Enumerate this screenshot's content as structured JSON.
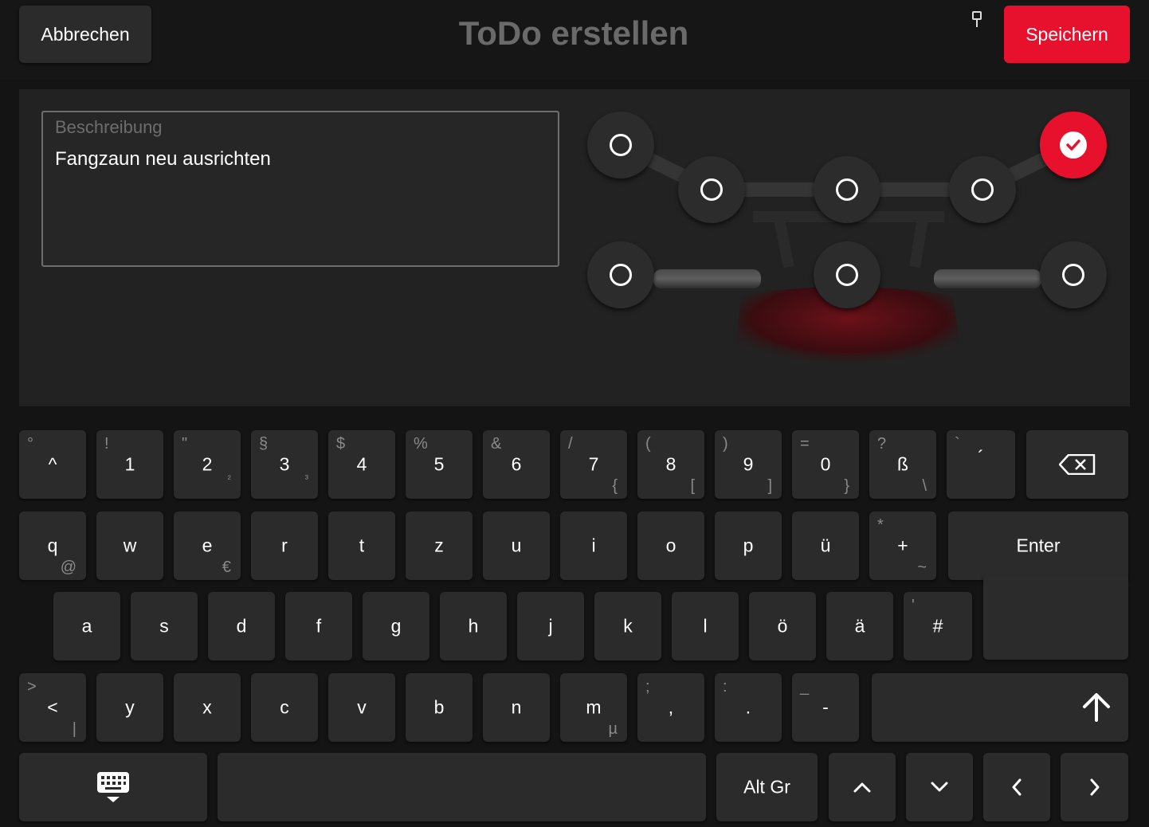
{
  "header": {
    "cancel_label": "Abbrechen",
    "title": "ToDo erstellen",
    "save_label": "Speichern",
    "accent_color": "#e8112d"
  },
  "description": {
    "label": "Beschreibung",
    "value": "Fangzaun neu ausrichten"
  },
  "positions": {
    "selected": "top-right",
    "icons": {
      "unselected": "circle-outline-icon",
      "selected": "check-circle-icon"
    }
  },
  "keyboard": {
    "row1": [
      {
        "main": "^",
        "alt": "°",
        "sub": ""
      },
      {
        "main": "1",
        "alt": "!",
        "sub": ""
      },
      {
        "main": "2",
        "alt": "\"",
        "sub": "²"
      },
      {
        "main": "3",
        "alt": "§",
        "sub": "³"
      },
      {
        "main": "4",
        "alt": "$",
        "sub": ""
      },
      {
        "main": "5",
        "alt": "%",
        "sub": ""
      },
      {
        "main": "6",
        "alt": "&",
        "sub": ""
      },
      {
        "main": "7",
        "alt": "/",
        "sub": "{"
      },
      {
        "main": "8",
        "alt": "(",
        "sub": "["
      },
      {
        "main": "9",
        "alt": ")",
        "sub": "]"
      },
      {
        "main": "0",
        "alt": "=",
        "sub": "}"
      },
      {
        "main": "ß",
        "alt": "?",
        "sub": "\\"
      },
      {
        "main": "´",
        "alt": "`",
        "sub": ""
      }
    ],
    "row2": [
      {
        "main": "q",
        "alt": "",
        "sub": "@"
      },
      {
        "main": "w",
        "alt": "",
        "sub": ""
      },
      {
        "main": "e",
        "alt": "",
        "sub": "€"
      },
      {
        "main": "r",
        "alt": "",
        "sub": ""
      },
      {
        "main": "t",
        "alt": "",
        "sub": ""
      },
      {
        "main": "z",
        "alt": "",
        "sub": ""
      },
      {
        "main": "u",
        "alt": "",
        "sub": ""
      },
      {
        "main": "i",
        "alt": "",
        "sub": ""
      },
      {
        "main": "o",
        "alt": "",
        "sub": ""
      },
      {
        "main": "p",
        "alt": "",
        "sub": ""
      },
      {
        "main": "ü",
        "alt": "",
        "sub": ""
      },
      {
        "main": "+",
        "alt": "*",
        "sub": "~"
      }
    ],
    "row3": [
      {
        "main": "a",
        "alt": "",
        "sub": ""
      },
      {
        "main": "s",
        "alt": "",
        "sub": ""
      },
      {
        "main": "d",
        "alt": "",
        "sub": ""
      },
      {
        "main": "f",
        "alt": "",
        "sub": ""
      },
      {
        "main": "g",
        "alt": "",
        "sub": ""
      },
      {
        "main": "h",
        "alt": "",
        "sub": ""
      },
      {
        "main": "j",
        "alt": "",
        "sub": ""
      },
      {
        "main": "k",
        "alt": "",
        "sub": ""
      },
      {
        "main": "l",
        "alt": "",
        "sub": ""
      },
      {
        "main": "ö",
        "alt": "",
        "sub": ""
      },
      {
        "main": "ä",
        "alt": "",
        "sub": ""
      },
      {
        "main": "#",
        "alt": "'",
        "sub": ""
      }
    ],
    "row4": [
      {
        "main": "<",
        "alt": ">",
        "sub": "|"
      },
      {
        "main": "y",
        "alt": "",
        "sub": ""
      },
      {
        "main": "x",
        "alt": "",
        "sub": ""
      },
      {
        "main": "c",
        "alt": "",
        "sub": ""
      },
      {
        "main": "v",
        "alt": "",
        "sub": ""
      },
      {
        "main": "b",
        "alt": "",
        "sub": ""
      },
      {
        "main": "n",
        "alt": "",
        "sub": ""
      },
      {
        "main": "m",
        "alt": "",
        "sub": "µ"
      },
      {
        "main": ",",
        "alt": ";",
        "sub": ""
      },
      {
        "main": ".",
        "alt": ":",
        "sub": ""
      },
      {
        "main": "-",
        "alt": "_",
        "sub": ""
      }
    ],
    "enter_label": "Enter",
    "altgr_label": "Alt Gr",
    "icons": {
      "backspace": "backspace-icon",
      "shift": "shift-arrow-up-icon",
      "hide_keyboard": "keyboard-hide-icon",
      "up": "chevron-up-icon",
      "down": "chevron-down-icon",
      "left": "chevron-left-icon",
      "right": "chevron-right-icon"
    }
  }
}
